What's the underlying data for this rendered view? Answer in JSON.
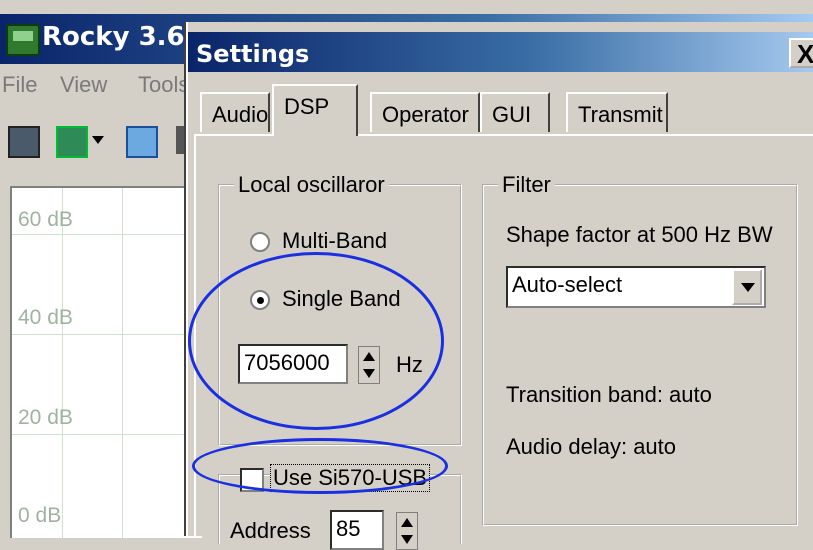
{
  "main_window": {
    "title": "Rocky 3.6",
    "menu": [
      "File",
      "View",
      "Tools"
    ],
    "spectrum": {
      "labels": [
        "60 dB",
        "40 dB",
        "20 dB",
        "0 dB"
      ]
    }
  },
  "dialog": {
    "title": "Settings",
    "close_label": "X",
    "tabs": [
      {
        "label": "Audio",
        "active": false
      },
      {
        "label": "DSP",
        "active": true
      },
      {
        "label": "Operator",
        "active": false
      },
      {
        "label": "GUI",
        "active": false
      },
      {
        "label": "Transmit",
        "active": false
      }
    ],
    "local_osc": {
      "title": "Local oscillaror",
      "multi_band": "Multi-Band",
      "single_band": "Single Band",
      "frequency": "7056000",
      "unit": "Hz",
      "selected": "Single Band"
    },
    "si570": {
      "label": "Use Si570-USB",
      "checked": false,
      "address_label": "Address",
      "address_value": "85"
    },
    "filter": {
      "title": "Filter",
      "shape_label": "Shape factor at 500 Hz BW",
      "shape_value": "Auto-select",
      "transition": "Transition band: auto",
      "audio_delay": "Audio delay: auto"
    }
  },
  "colors": {
    "highlight_ellipse": "#1a2fe0",
    "titlebar": "#0a246a"
  }
}
